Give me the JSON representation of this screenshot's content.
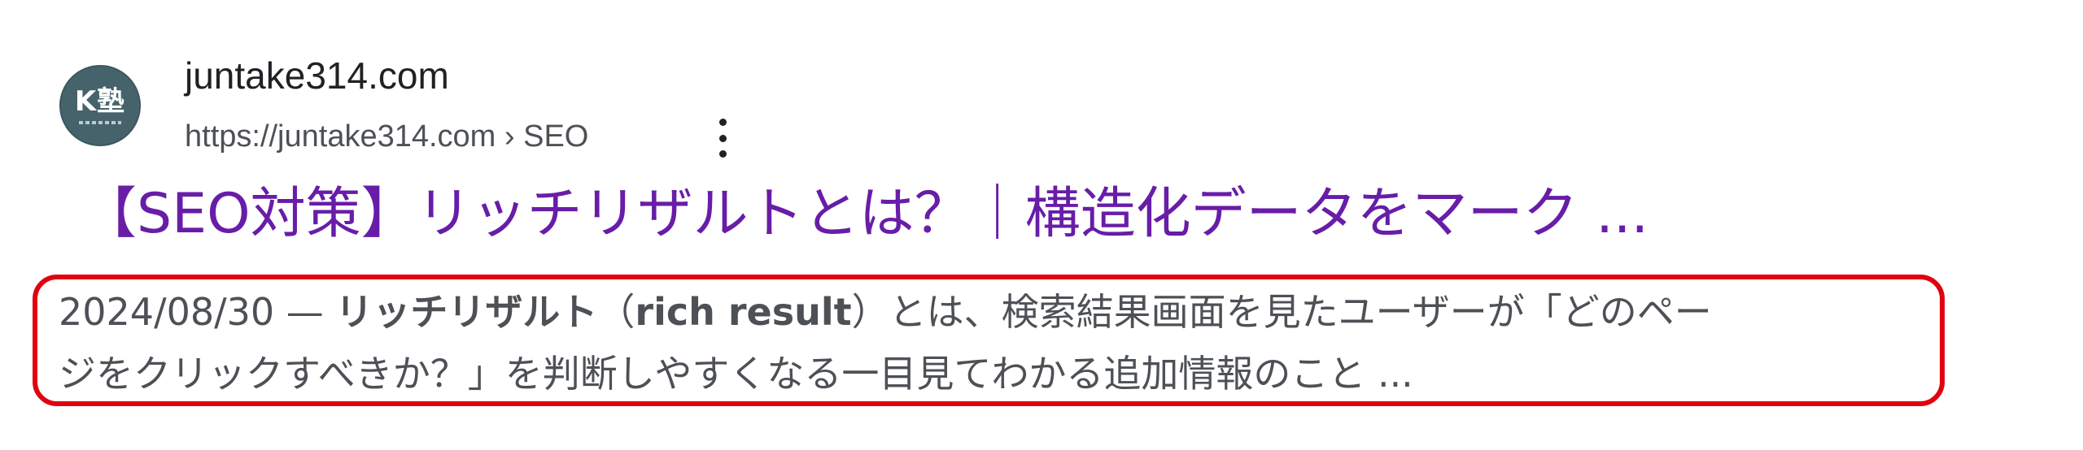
{
  "result": {
    "favicon": {
      "icon": "k-juku-logo-icon",
      "text": "K塾",
      "background": "#46636c"
    },
    "site_name": "juntake314.com",
    "url": "https://juntake314.com › SEO",
    "menu_icon": "three-dots-vertical-icon",
    "title": "【SEO対策】リッチリザルトとは？｜構造化データをマーク ...",
    "snippet": {
      "date": "2024/08/30",
      "separator": " — ",
      "bold_term": "リッチリザルト",
      "paren_open": "（",
      "bold_term_en": "rich result",
      "line1_rest": "）とは、検索結果画面を見たユーザーが「どのペー",
      "line2": "ジをクリックすべきか？」を判断しやすくなる一目見てわかる追加情報のこと ..."
    },
    "highlight_color": "#e00010",
    "title_color": "#681da8"
  }
}
